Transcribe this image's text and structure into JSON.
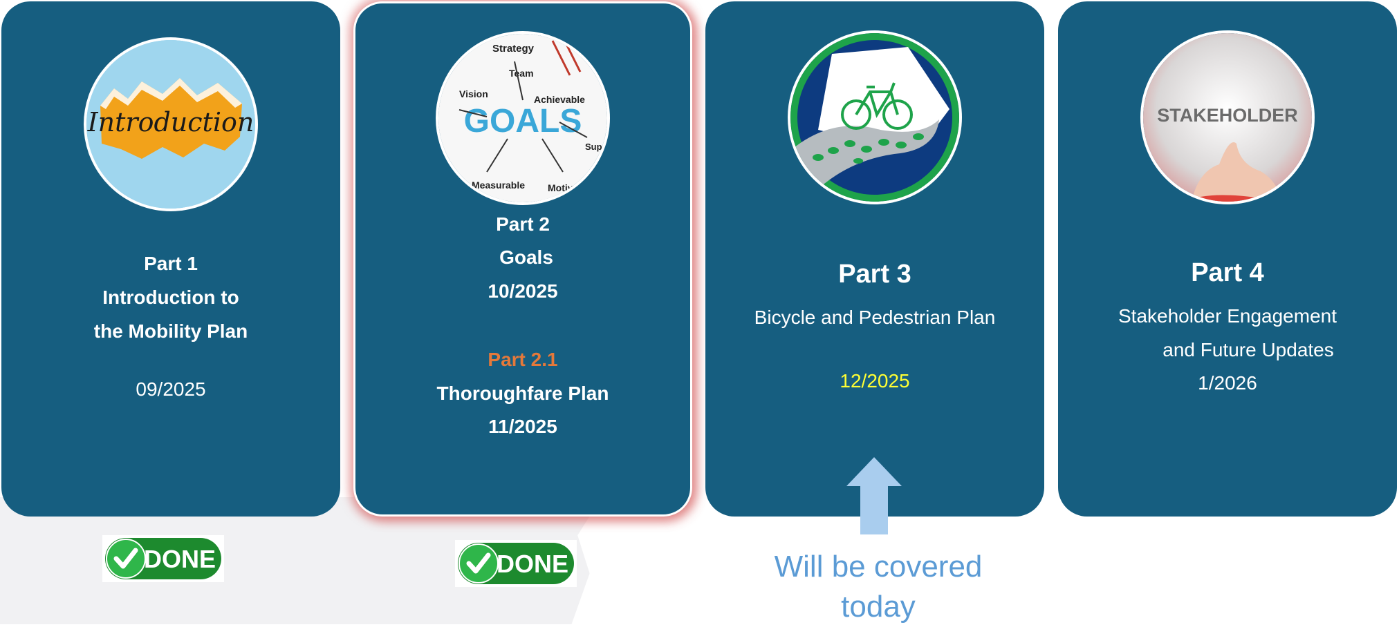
{
  "cards": [
    {
      "image_label": "Introduction",
      "lines": [
        "Part 1",
        "Introduction to",
        "the Mobility Plan"
      ],
      "date": "09/2025"
    },
    {
      "image_labels": [
        "GOALS",
        "Strategy",
        "Team",
        "Vision",
        "Achievable",
        "Measurable",
        "Motivat",
        "Sup"
      ],
      "lines": [
        "Part 2",
        "Goals",
        "10/2025"
      ],
      "sub_title": "Part 2.1",
      "sub_lines": [
        "Thoroughfare Plan",
        "11/2025"
      ]
    },
    {
      "title": "Part 3",
      "subtitle": "Bicycle and Pedestrian Plan",
      "date": "12/2025"
    },
    {
      "image_label": "STAKEHOLDER",
      "title": "Part 4",
      "lines": [
        "Stakeholder Engagement",
        "and Future Updates"
      ],
      "date": "1/2026"
    }
  ],
  "done_badges": [
    "DONE",
    "DONE"
  ],
  "callout": [
    "Will be covered",
    "today"
  ],
  "colors": {
    "card_bg": "#165e80",
    "accent_orange": "#e5793a",
    "date_highlight": "#ffff33",
    "callout_blue": "#5b9bd5",
    "badge_green": "#1d8a2e"
  },
  "icons": [
    "checkmark-icon",
    "up-arrow-icon",
    "bicycle-icon"
  ]
}
